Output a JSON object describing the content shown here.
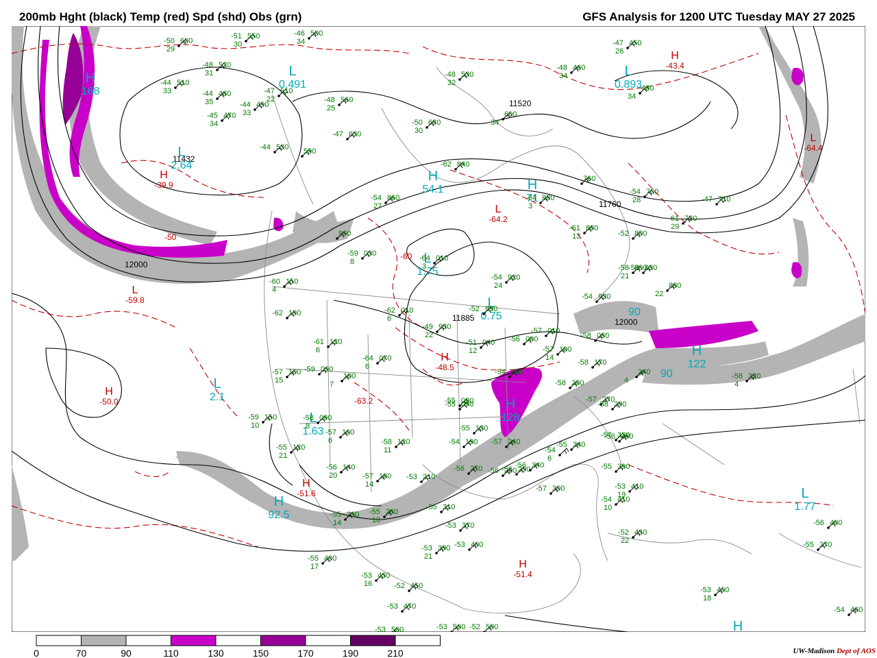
{
  "header": {
    "left_title": "200mb Hght (black) Temp (red) Spd (shd) Obs (grn)",
    "right_title": "GFS Analysis for 1200 UTC Tuesday  MAY 27 2025"
  },
  "colors": {
    "height_contours": "#000000",
    "temperature_contours": "#c00000",
    "observations": "#007a00",
    "speed_labels": "#00a8b8",
    "speed_70_90": "#b4b4b4",
    "speed_110_130": "#c800c8",
    "speed_150_170": "#960096",
    "speed_190_210": "#640064",
    "borders": "#808080"
  },
  "colorbar": {
    "labels": [
      "0",
      "70",
      "90",
      "110",
      "130",
      "150",
      "170",
      "190",
      "210"
    ],
    "fills": [
      "#ffffff",
      "#b4b4b4",
      "#ffffff",
      "#c800c8",
      "#ffffff",
      "#960096",
      "#ffffff",
      "#640064",
      "#ffffff"
    ]
  },
  "credit": {
    "org": "UW-Madison",
    "dept": "Dept of AOS"
  },
  "height_labels": [
    "11520",
    "11760",
    "12000",
    "12000",
    "11885",
    "11432"
  ],
  "pressure_centers": [
    {
      "type": "H",
      "value": "168",
      "kind": "speed"
    },
    {
      "type": "L",
      "value": "0.491",
      "kind": "speed"
    },
    {
      "type": "L",
      "value": "0.893",
      "kind": "speed"
    },
    {
      "type": "L",
      "value": "2.64",
      "kind": "speed"
    },
    {
      "type": "H",
      "value": "54.1",
      "kind": "speed"
    },
    {
      "type": "H",
      "value": "71",
      "kind": "speed"
    },
    {
      "type": "L",
      "value": "1.75",
      "kind": "speed"
    },
    {
      "type": "L",
      "value": "0.75",
      "kind": "speed"
    },
    {
      "type": "L",
      "value": "2.1",
      "kind": "speed"
    },
    {
      "type": "L",
      "value": "1.63",
      "kind": "speed"
    },
    {
      "type": "H",
      "value": "92.5",
      "kind": "speed"
    },
    {
      "type": "H",
      "value": "128",
      "kind": "speed"
    },
    {
      "type": "H",
      "value": "122",
      "kind": "speed"
    },
    {
      "type": "L",
      "value": "1.77",
      "kind": "speed"
    },
    {
      "type": "H",
      "value": "",
      "kind": "speed"
    },
    {
      "type": "H",
      "value": "-43.4",
      "kind": "temp"
    },
    {
      "type": "H",
      "value": "-39.9",
      "kind": "temp"
    },
    {
      "type": "H",
      "value": "-50.0",
      "kind": "temp"
    },
    {
      "type": "L",
      "value": "-59.8",
      "kind": "temp"
    },
    {
      "type": "H",
      "value": "-48.5",
      "kind": "temp"
    },
    {
      "type": "H",
      "value": "-51.6",
      "kind": "temp"
    },
    {
      "type": "H",
      "value": "-51.4",
      "kind": "temp"
    },
    {
      "type": "L",
      "value": "-64.2",
      "kind": "temp"
    },
    {
      "type": "L",
      "value": "-64.4",
      "kind": "temp"
    }
  ],
  "temp_labels": [
    "-50",
    "-60",
    "-63.2"
  ],
  "speed_values": [
    "90",
    "90"
  ],
  "observations": [
    {
      "t": "-50",
      "h": "600",
      "d": "29"
    },
    {
      "t": "-51",
      "h": "550",
      "d": "30"
    },
    {
      "t": "-46",
      "h": "500",
      "d": "34"
    },
    {
      "t": "-48",
      "h": "520",
      "d": "31"
    },
    {
      "t": "-44",
      "h": "510",
      "d": "33"
    },
    {
      "t": "-47",
      "h": "510",
      "d": "22"
    },
    {
      "t": "-44",
      "h": "480",
      "d": "35"
    },
    {
      "t": "-44",
      "h": "490",
      "d": "33"
    },
    {
      "t": "-45",
      "h": "470",
      "d": "34"
    },
    {
      "t": "-48",
      "h": "560",
      "d": "25"
    },
    {
      "t": "-47",
      "h": "630",
      "d": ""
    },
    {
      "t": "-44",
      "h": "530",
      "d": ""
    },
    {
      "t": "",
      "h": "590",
      "d": ""
    },
    {
      "t": "-50",
      "h": "680",
      "d": "30"
    },
    {
      "t": "-48",
      "h": "530",
      "d": "32"
    },
    {
      "t": "",
      "h": "600",
      "d": "34"
    },
    {
      "t": "-48",
      "h": "460",
      "d": "34"
    },
    {
      "t": "-47",
      "h": "450",
      "d": "26"
    },
    {
      "t": "",
      "h": "480",
      "d": "34"
    },
    {
      "t": "-62",
      "h": "840",
      "d": ""
    },
    {
      "t": "",
      "h": "760",
      "d": ""
    },
    {
      "t": "-54",
      "h": "700",
      "d": "28"
    },
    {
      "t": "-47",
      "h": "710",
      "d": ""
    },
    {
      "t": "-61",
      "h": "730",
      "d": "29"
    },
    {
      "t": "-52",
      "h": "800",
      "d": ""
    },
    {
      "t": "-54",
      "h": "860",
      "d": "27"
    },
    {
      "t": "-64",
      "h": "880",
      "d": "3"
    },
    {
      "t": "-61",
      "h": "880",
      "d": "13"
    },
    {
      "t": "-58",
      "h": "800",
      "d": "21"
    },
    {
      "t": "-58",
      "h": "830",
      "d": ""
    },
    {
      "t": "",
      "h": "880",
      "d": "22"
    },
    {
      "t": "",
      "h": "990",
      "d": ""
    },
    {
      "t": "-59",
      "h": "030",
      "d": "8"
    },
    {
      "t": "-64",
      "h": "010",
      "d": "3"
    },
    {
      "t": "-54",
      "h": "920",
      "d": "24"
    },
    {
      "t": "-60",
      "h": "150",
      "d": "4"
    },
    {
      "t": "-62",
      "h": "190",
      "d": ""
    },
    {
      "t": "-62",
      "h": "010",
      "d": "6"
    },
    {
      "t": "-52",
      "h": "890",
      "d": ""
    },
    {
      "t": "-54",
      "h": "930",
      "d": ""
    },
    {
      "t": "-49",
      "h": "930",
      "d": "22"
    },
    {
      "t": "-61",
      "h": "120",
      "d": "6"
    },
    {
      "t": "-51",
      "h": "040",
      "d": "12"
    },
    {
      "t": "-56",
      "h": "000",
      "d": ""
    },
    {
      "t": "-57",
      "h": "010",
      "d": ""
    },
    {
      "t": "-58",
      "h": "080",
      "d": ""
    },
    {
      "t": "-57",
      "h": "100",
      "d": "14"
    },
    {
      "t": "-64",
      "h": "070",
      "d": "6"
    },
    {
      "t": "-57",
      "h": "100",
      "d": "15"
    },
    {
      "t": "-59",
      "h": "090",
      "d": ""
    },
    {
      "t": "",
      "h": "100",
      "d": "7"
    },
    {
      "t": "-54",
      "h": "050",
      "d": ""
    },
    {
      "t": "-58",
      "h": "170",
      "d": ""
    },
    {
      "t": "",
      "h": "240",
      "d": "4"
    },
    {
      "t": "-58",
      "h": "320",
      "d": "4"
    },
    {
      "t": "-58",
      "h": "200",
      "d": ""
    },
    {
      "t": "-57",
      "h": "270",
      "d": ""
    },
    {
      "t": "-59",
      "h": "150",
      "d": "10"
    },
    {
      "t": "-58",
      "h": "090",
      "d": "8"
    },
    {
      "t": "-55",
      "h": "090",
      "d": ""
    },
    {
      "t": "-55",
      "h": "090",
      "d": ""
    },
    {
      "t": "-57",
      "h": "100",
      "d": "6"
    },
    {
      "t": "-58",
      "h": "120",
      "d": "11"
    },
    {
      "t": "-55",
      "h": "120",
      "d": "21"
    },
    {
      "t": "-55",
      "h": "130",
      "d": ""
    },
    {
      "t": "-54",
      "h": "190",
      "d": ""
    },
    {
      "t": "-57",
      "h": "240",
      "d": ""
    },
    {
      "t": "-56",
      "h": "290",
      "d": ""
    },
    {
      "t": "-58",
      "h": "290",
      "d": ""
    },
    {
      "t": "-57",
      "h": "320",
      "d": ""
    },
    {
      "t": "-56",
      "h": "360",
      "d": ""
    },
    {
      "t": "-55",
      "h": "340",
      "d": ""
    },
    {
      "t": "-54",
      "h": "",
      "d": "6"
    },
    {
      "t": "-56",
      "h": "140",
      "d": "20"
    },
    {
      "t": "-57",
      "h": "180",
      "d": "14"
    },
    {
      "t": "-53",
      "h": "210",
      "d": ""
    },
    {
      "t": "-56",
      "h": "270",
      "d": ""
    },
    {
      "t": "-56",
      "h": "290",
      "d": ""
    },
    {
      "t": "-56",
      "h": "340",
      "d": ""
    },
    {
      "t": "-57",
      "h": "300",
      "d": ""
    },
    {
      "t": "-55",
      "h": "390",
      "d": ""
    },
    {
      "t": "-53",
      "h": "410",
      "d": "19"
    },
    {
      "t": "-54",
      "h": "410",
      "d": "10"
    },
    {
      "t": "-52",
      "h": "430",
      "d": "22"
    },
    {
      "t": "-55",
      "h": "290",
      "d": "14"
    },
    {
      "t": "-55",
      "h": "280",
      "d": "18"
    },
    {
      "t": "-55",
      "h": "310",
      "d": ""
    },
    {
      "t": "-53",
      "h": "370",
      "d": ""
    },
    {
      "t": "-53",
      "h": "390",
      "d": "21"
    },
    {
      "t": "-53",
      "h": "400",
      "d": ""
    },
    {
      "t": "-55",
      "h": "400",
      "d": "17"
    },
    {
      "t": "-53",
      "h": "430",
      "d": "16"
    },
    {
      "t": "-52",
      "h": "450",
      "d": ""
    },
    {
      "t": "-53",
      "h": "470",
      "d": ""
    },
    {
      "t": "-53",
      "h": "500",
      "d": ""
    },
    {
      "t": "-53",
      "h": "500",
      "d": ""
    },
    {
      "t": "-52",
      "h": "500",
      "d": ""
    },
    {
      "t": "-56",
      "h": "400",
      "d": ""
    },
    {
      "t": "-55",
      "h": "370",
      "d": ""
    },
    {
      "t": "-53",
      "h": "400",
      "d": "18"
    },
    {
      "t": "-54",
      "h": "460",
      "d": ""
    }
  ]
}
